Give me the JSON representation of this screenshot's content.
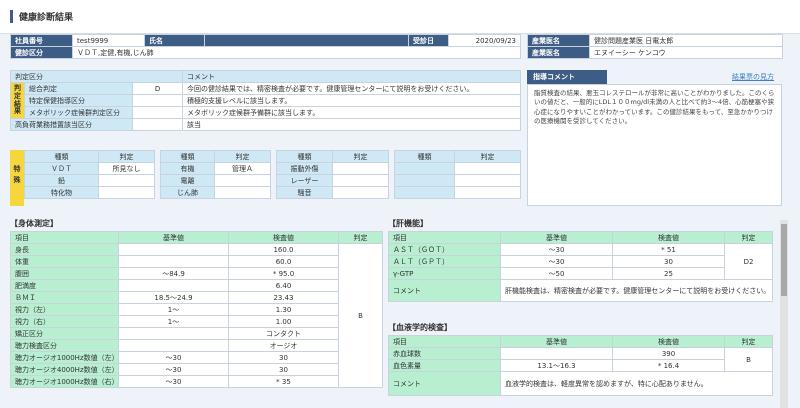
{
  "page_title": "健康診断結果",
  "header": {
    "employee_no_label": "社員番号",
    "employee_no": "test9999",
    "name_label": "氏名",
    "name": "",
    "exam_date_label": "受診日",
    "exam_date": "2020/09/23",
    "doctor_label": "産業医名",
    "doctor": "健診問題産業医 日電太郎",
    "category_label": "健診区分",
    "category": "ＶＤＴ,定健,有機,じん肺",
    "nurse_label": "産業医名",
    "nurse": "エヌイーシー ケンコウ"
  },
  "judgment": {
    "col1": "判定区分",
    "col2": "コメント",
    "side_label": "判定結果",
    "rows": [
      {
        "label": "総合判定",
        "value": "D",
        "comment": "今回の健診結果では、精密検査が必要です。健康管理センターにて説明をお受けください。"
      },
      {
        "label": "特定保健指導区分",
        "value": "",
        "comment": "積極的支援レベルに該当します。"
      },
      {
        "label": "メタボリック症候群判定区分",
        "value": "",
        "comment": "メタボリック症候群予備群に該当します。"
      },
      {
        "label": "高負荷業務措置該当区分",
        "value": "",
        "comment": "該当"
      }
    ]
  },
  "guidance": {
    "title": "指導コメント",
    "link": "結果票の見方",
    "text": "脂質検査の結果、悪玉コレステロールが非常に高いことがわかりました。このくらいの値だと、一般的にLDL１００mg/dl未満の人と比べて約3〜4倍、心筋梗塞や狭心症になりやすいことがわかっています。この健診結果をもって、至急かかりつけの医療機関を受診してください。"
  },
  "special": {
    "side_label": "特殊",
    "col_type": "種類",
    "col_judge": "判定",
    "groups": [
      [
        {
          "type": "ＶＤＴ",
          "judge": "所見なし"
        },
        {
          "type": "鉛",
          "judge": ""
        },
        {
          "type": "特化物",
          "judge": ""
        }
      ],
      [
        {
          "type": "有機",
          "judge": "管理Ａ"
        },
        {
          "type": "電離",
          "judge": ""
        },
        {
          "type": "じん肺",
          "judge": ""
        }
      ],
      [
        {
          "type": "振動外傷",
          "judge": ""
        },
        {
          "type": "レーザー",
          "judge": ""
        },
        {
          "type": "騒音",
          "judge": ""
        }
      ],
      [
        {
          "type": "",
          "judge": ""
        },
        {
          "type": "",
          "judge": ""
        },
        {
          "type": "",
          "judge": ""
        }
      ]
    ]
  },
  "body": {
    "title": "【身体測定】",
    "headers": [
      "項目",
      "基準値",
      "検査値",
      "判定"
    ],
    "judge": "B",
    "rows": [
      {
        "item": "身長",
        "ref": "",
        "value": "160.0"
      },
      {
        "item": "体重",
        "ref": "",
        "value": "60.0"
      },
      {
        "item": "腹囲",
        "ref": "〜84.9",
        "value": "* 95.0"
      },
      {
        "item": "肥満度",
        "ref": "",
        "value": "6.40"
      },
      {
        "item": "ＢＭＩ",
        "ref": "18.5〜24.9",
        "value": "23.43"
      },
      {
        "item": "視力（左）",
        "ref": "1〜",
        "value": "1.30"
      },
      {
        "item": "視力（右）",
        "ref": "1〜",
        "value": "1.00"
      },
      {
        "item": "矯正区分",
        "ref": "",
        "value": "コンタクト"
      },
      {
        "item": "聴力検査区分",
        "ref": "",
        "value": "オージオ"
      },
      {
        "item": "聴力オージオ1000Hz数値（左）",
        "ref": "〜30",
        "value": "30"
      },
      {
        "item": "聴力オージオ4000Hz数値（左）",
        "ref": "〜30",
        "value": "30"
      },
      {
        "item": "聴力オージオ1000Hz数値（右）",
        "ref": "〜30",
        "value": "* 35"
      }
    ]
  },
  "liver": {
    "title": "【肝機能】",
    "headers": [
      "項目",
      "基準値",
      "検査値",
      "判定"
    ],
    "judge": "D2",
    "rows": [
      {
        "item": "ＡＳＴ（ＧＯＴ）",
        "ref": "〜30",
        "value": "* 51"
      },
      {
        "item": "ＡＬＴ（ＧＰＴ）",
        "ref": "〜30",
        "value": "30"
      },
      {
        "item": "γ-GTP",
        "ref": "〜50",
        "value": "25"
      }
    ],
    "comment_label": "コメント",
    "comment": "肝機能検査は、精密検査が必要です。健康管理センターにて説明をお受けください。"
  },
  "blood": {
    "title": "【血液学的検査】",
    "headers": [
      "項目",
      "基準値",
      "検査値",
      "判定"
    ],
    "judge": "B",
    "rows": [
      {
        "item": "赤血球数",
        "ref": "",
        "value": "390"
      },
      {
        "item": "血色素量",
        "ref": "13.1〜16.3",
        "value": "* 16.4"
      }
    ],
    "comment_label": "コメント",
    "comment": "血液学的検査は、軽度異常を認めますが、特に心配ありません。"
  }
}
